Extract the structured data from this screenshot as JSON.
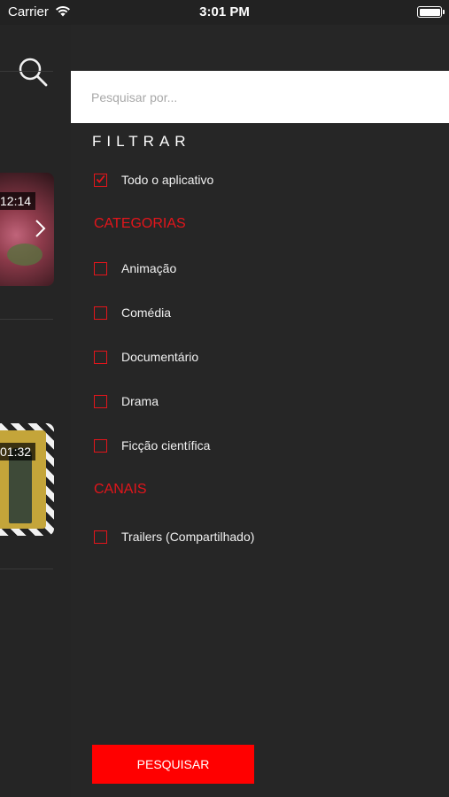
{
  "status_bar": {
    "carrier": "Carrier",
    "time": "3:01 PM"
  },
  "background_app": {
    "cards": [
      {
        "duration": "12:14"
      },
      {
        "duration": "01:32"
      }
    ]
  },
  "filter_panel": {
    "search": {
      "placeholder": "Pesquisar por..."
    },
    "title": "FILTRAR",
    "whole_app": {
      "label": "Todo o aplicativo",
      "checked": true
    },
    "categories": {
      "heading": "CATEGORIAS",
      "items": [
        {
          "label": "Animação",
          "checked": false
        },
        {
          "label": "Comédia",
          "checked": false
        },
        {
          "label": "Documentário",
          "checked": false
        },
        {
          "label": "Drama",
          "checked": false
        },
        {
          "label": "Ficção científica",
          "checked": false
        }
      ]
    },
    "channels": {
      "heading": "CANAIS",
      "items": [
        {
          "label": "Trailers (Compartilhado)",
          "checked": false
        }
      ]
    },
    "submit_label": "PESQUISAR"
  },
  "colors": {
    "accent": "#e3151b",
    "button": "#ff0000",
    "panel_bg": "#262626"
  }
}
